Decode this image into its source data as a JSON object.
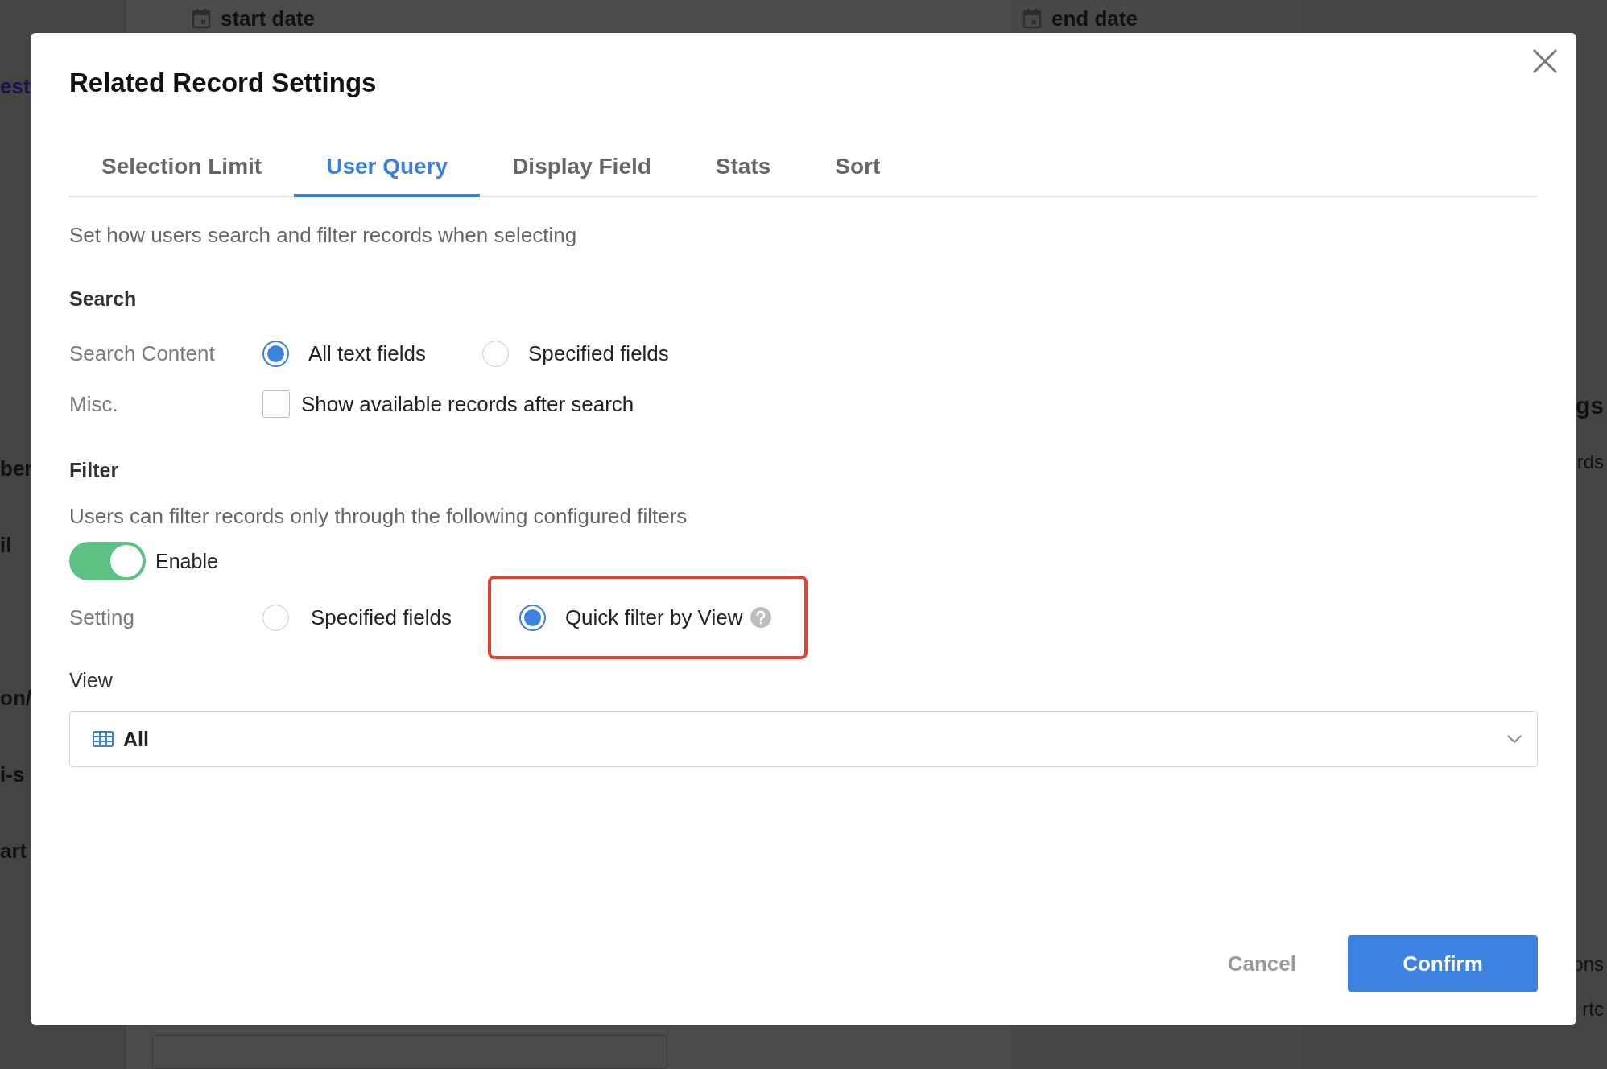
{
  "background": {
    "fields": [
      "start date",
      "end date"
    ],
    "left_fragments": [
      "est",
      "ber",
      "il",
      "on/",
      "i-s",
      "art"
    ],
    "right_fragments": [
      "gs",
      "rds",
      "ons",
      "rtc"
    ]
  },
  "dialog": {
    "title": "Related Record Settings",
    "tabs": [
      {
        "label": "Selection Limit",
        "selected": false
      },
      {
        "label": "User Query",
        "selected": true
      },
      {
        "label": "Display Field",
        "selected": false
      },
      {
        "label": "Stats",
        "selected": false
      },
      {
        "label": "Sort",
        "selected": false
      }
    ],
    "description": "Set how users search and filter records when selecting",
    "search": {
      "heading": "Search",
      "rows": [
        {
          "kind": "radio",
          "label": "Search Content",
          "options": [
            {
              "label": "All text fields",
              "selected": true
            },
            {
              "label": "Specified fields",
              "selected": false
            }
          ]
        },
        {
          "kind": "checkbox",
          "label": "Misc.",
          "options": [
            {
              "label": "Show available records after search",
              "checked": false
            }
          ]
        }
      ]
    },
    "filter": {
      "heading": "Filter",
      "note": "Users can filter records only through the following configured filters",
      "toggle": {
        "label": "Enable",
        "on": true
      },
      "rows": [
        {
          "kind": "radio",
          "label": "Setting",
          "options": [
            {
              "label": "Specified fields",
              "selected": false,
              "highlighted": false,
              "help": false
            },
            {
              "label": "Quick filter by View",
              "selected": true,
              "highlighted": true,
              "help": true
            }
          ]
        }
      ]
    },
    "view": {
      "label": "View",
      "value": "All"
    },
    "buttons": [
      {
        "kind": "secondary",
        "label": "Cancel"
      },
      {
        "kind": "primary",
        "label": "Confirm"
      }
    ]
  }
}
